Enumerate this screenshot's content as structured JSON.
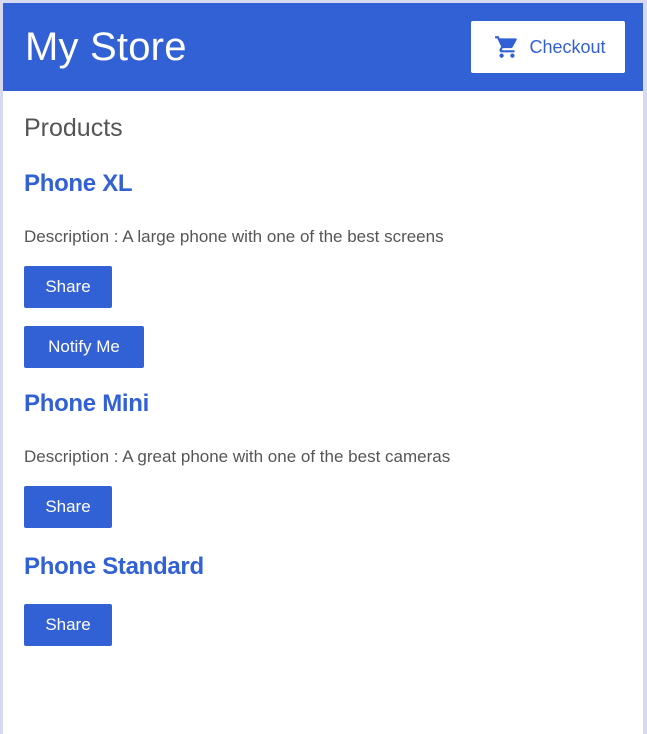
{
  "header": {
    "title": "My Store",
    "checkout_label": "Checkout",
    "checkout_icon": "shopping-cart-icon"
  },
  "main": {
    "section_title": "Products",
    "products": [
      {
        "name": "Phone XL",
        "description": "Description : A large phone with one of the best screens",
        "share_label": "Share",
        "notify_label": "Notify Me"
      },
      {
        "name": "Phone Mini",
        "description": "Description : A great phone with one of the best cameras",
        "share_label": "Share"
      },
      {
        "name": "Phone Standard",
        "share_label": "Share"
      }
    ]
  },
  "colors": {
    "brand_blue": "#3260d5",
    "text_gray": "#555555",
    "background": "#ffffff"
  }
}
